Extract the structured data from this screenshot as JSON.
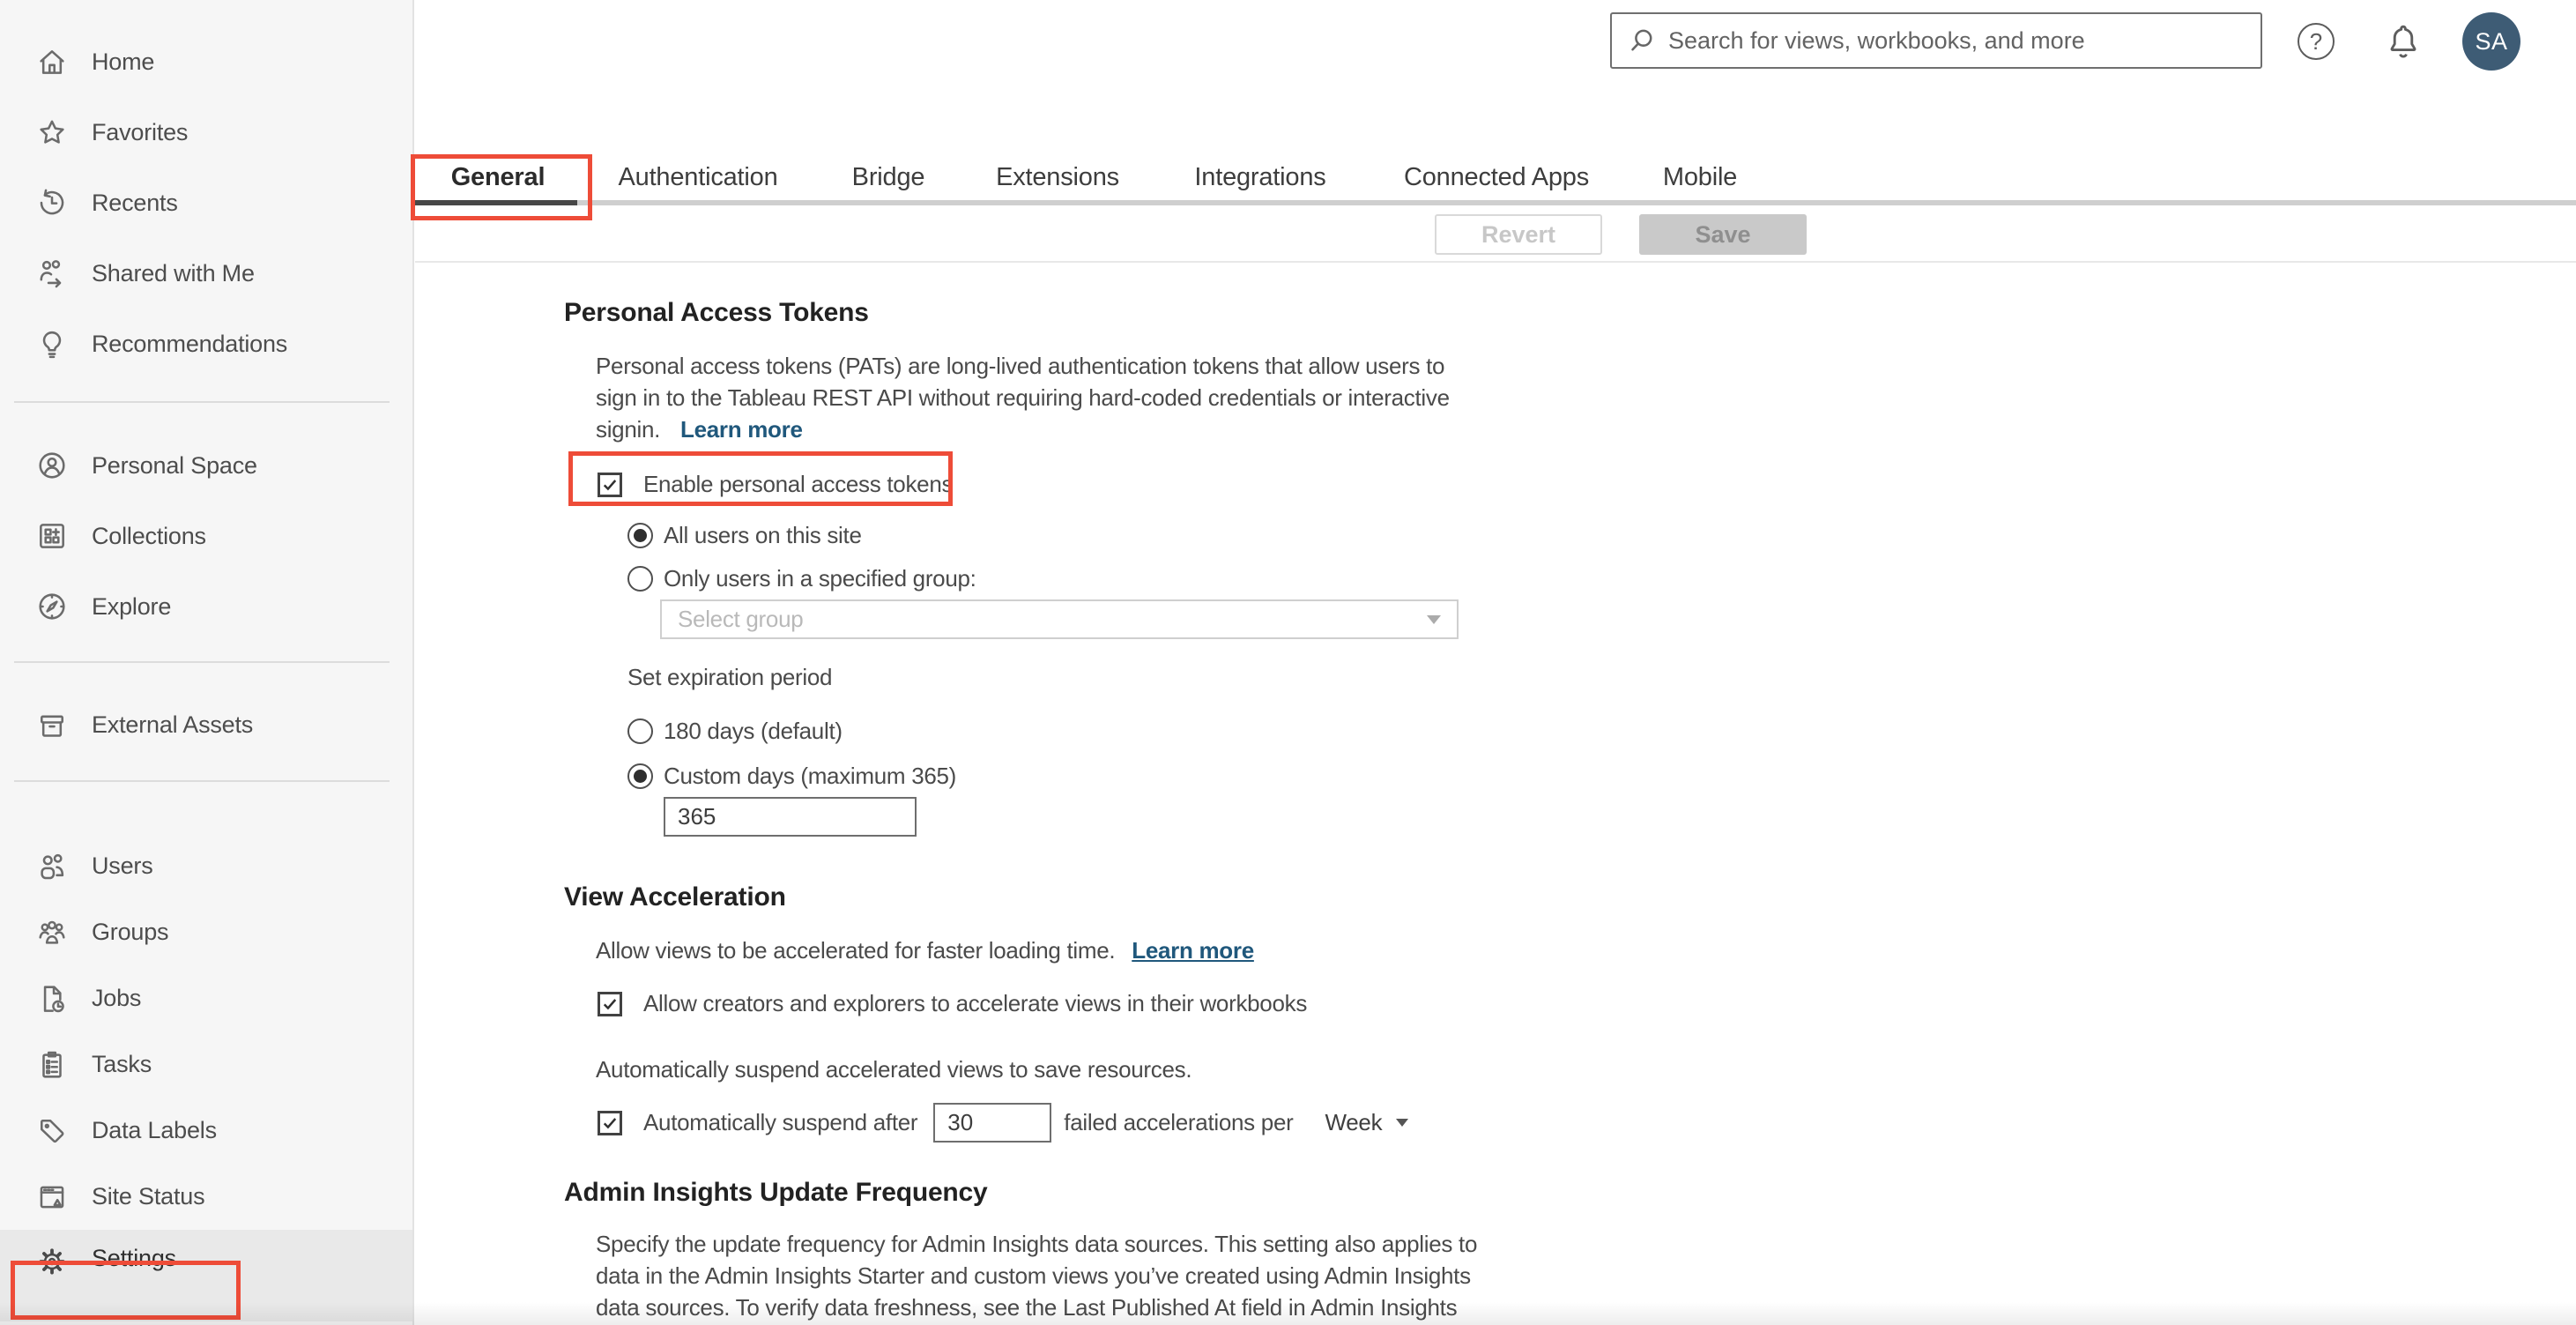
{
  "colors": {
    "highlight_red": "#ee4c38",
    "link_blue": "#20587c",
    "avatar_bg": "#3e5c75",
    "active_tab_underline": "#474747"
  },
  "sidebar": {
    "items": [
      {
        "icon": "home-icon",
        "label": "Home"
      },
      {
        "icon": "star-icon",
        "label": "Favorites"
      },
      {
        "icon": "history-icon",
        "label": "Recents"
      },
      {
        "icon": "shared-icon",
        "label": "Shared with Me"
      },
      {
        "icon": "lightbulb-icon",
        "label": "Recommendations"
      },
      {
        "icon": "person-circle-icon",
        "label": "Personal Space"
      },
      {
        "icon": "collections-icon",
        "label": "Collections"
      },
      {
        "icon": "compass-icon",
        "label": "Explore"
      },
      {
        "icon": "archive-box-icon",
        "label": "External Assets"
      },
      {
        "icon": "users-icon",
        "label": "Users"
      },
      {
        "icon": "groups-icon",
        "label": "Groups"
      },
      {
        "icon": "document-clock-icon",
        "label": "Jobs"
      },
      {
        "icon": "clipboard-icon",
        "label": "Tasks"
      },
      {
        "icon": "tag-icon",
        "label": "Data Labels"
      },
      {
        "icon": "browser-alert-icon",
        "label": "Site Status"
      },
      {
        "icon": "gear-icon",
        "label": "Settings"
      }
    ],
    "selected_item": "Settings"
  },
  "topbar": {
    "search_placeholder": "Search for views, workbooks, and more",
    "help_glyph": "?",
    "avatar_initials": "SA"
  },
  "tabs": {
    "items": [
      {
        "label": "General"
      },
      {
        "label": "Authentication"
      },
      {
        "label": "Bridge"
      },
      {
        "label": "Extensions"
      },
      {
        "label": "Integrations"
      },
      {
        "label": "Connected Apps"
      },
      {
        "label": "Mobile"
      }
    ],
    "active": "General"
  },
  "toolbar": {
    "revert_label": "Revert",
    "save_label": "Save"
  },
  "sections": {
    "pat": {
      "title": "Personal Access Tokens",
      "desc_line1": "Personal access tokens (PATs) are long-lived authentication tokens that allow users to",
      "desc_line2": "sign in to the Tableau REST API without requiring hard-coded credentials or interactive",
      "desc_line3": "signin.",
      "learn_more": "Learn more",
      "enable_label": "Enable personal access tokens",
      "enable_checked": true,
      "radio_all_users": "All users on this site",
      "radio_all_users_selected": true,
      "radio_specified_group": "Only users in a specified group:",
      "radio_specified_group_selected": false,
      "select_group_placeholder": "Select group",
      "expiration_label": "Set expiration period",
      "radio_180_days": "180 days (default)",
      "radio_180_days_selected": false,
      "radio_custom_days": "Custom days (maximum 365)",
      "radio_custom_days_selected": true,
      "custom_days_value": "365"
    },
    "view_acceleration": {
      "title": "View Acceleration",
      "desc": "Allow views to be accelerated for faster loading time.",
      "learn_more": "Learn more",
      "allow_label": "Allow creators and explorers to accelerate views in their workbooks",
      "allow_checked": true,
      "suspend_desc": "Automatically suspend accelerated views to save resources.",
      "suspend_prefix": "Automatically suspend after",
      "suspend_checked": true,
      "suspend_count_value": "30",
      "suspend_suffix": "failed accelerations per",
      "period_value": "Week"
    },
    "admin_insights": {
      "title": "Admin Insights Update Frequency",
      "desc_line1": "Specify the update frequency for Admin Insights data sources. This setting also applies to",
      "desc_line2": "data in the Admin Insights Starter and custom views you’ve created using Admin Insights",
      "desc_line3": "data sources. To verify data freshness, see the Last Published At field in Admin Insights"
    }
  }
}
